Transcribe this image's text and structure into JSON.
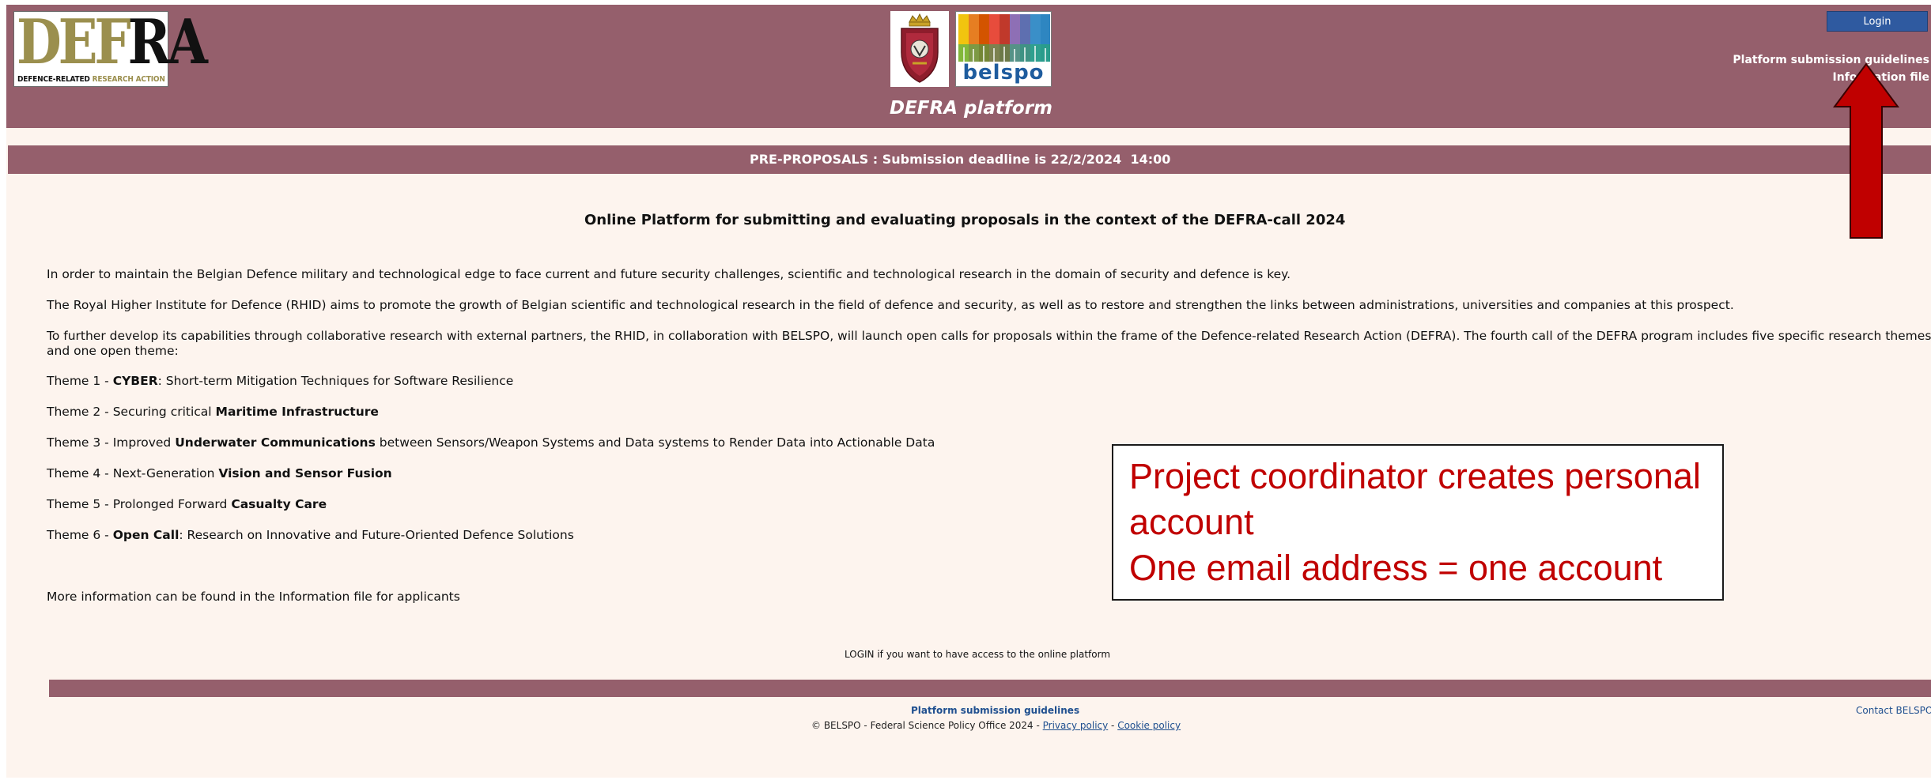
{
  "header": {
    "logo": {
      "big_part1": "DEF",
      "big_part2": "RA",
      "tag_part1": "DEFENCE-RELATED ",
      "tag_part2": "RESEARCH ACTION"
    },
    "belspo_label": "belspo",
    "platform_title": "DEFRA platform",
    "login_label": "Login",
    "links": {
      "guidelines": "Platform submission guidelines",
      "info_file": "Information file"
    }
  },
  "banner": {
    "text": "PRE-PROPOSALS : Submission deadline is 22/2/2024  14:00"
  },
  "main": {
    "heading": "Online Platform for submitting and evaluating proposals in the context of the DEFRA-call 2024",
    "paragraphs": [
      "In order to maintain the Belgian Defence military and technological edge to face current and future security challenges, scientific and technological research in the domain of security and defence is key.",
      "The Royal Higher Institute for Defence (RHID) aims to promote the growth of Belgian scientific and technological research in the field of defence and security, as well as to restore and strengthen the links between administrations, universities and companies at this prospect.",
      "To further develop its capabilities through collaborative research with external partners, the RHID, in collaboration with BELSPO, will launch open calls for proposals within the frame of the Defence-related Research Action (DEFRA). The fourth call of the DEFRA program includes five specific research themes and one open theme:"
    ],
    "themes": [
      {
        "prefix": "Theme 1 - ",
        "bold": "CYBER",
        "suffix": ": Short-term Mitigation Techniques for Software Resilience"
      },
      {
        "prefix": "Theme 2 - Securing critical ",
        "bold": "Maritime Infrastructure",
        "suffix": ""
      },
      {
        "prefix": "Theme 3 - Improved ",
        "bold": "Underwater Communications",
        "suffix": " between Sensors/Weapon Systems and Data systems to Render Data into Actionable Data"
      },
      {
        "prefix": "Theme 4 - Next-Generation ",
        "bold": "Vision and Sensor Fusion",
        "suffix": ""
      },
      {
        "prefix": "Theme 5 - Prolonged Forward ",
        "bold": "Casualty Care",
        "suffix": ""
      },
      {
        "prefix": "Theme 6 - ",
        "bold": "Open Call",
        "suffix": ": Research on Innovative and Future-Oriented Defence Solutions"
      }
    ],
    "more_info": "More information can be found in the Information file for applicants",
    "login_note": "LOGIN if you want to have access to the online platform"
  },
  "overlay": {
    "line1": "Project coordinator creates personal account",
    "line2": "One email address = one account",
    "text_color": "#c00000"
  },
  "footer": {
    "guidelines": "Platform submission guidelines",
    "contact": "Contact BELSPO",
    "copyright": "© BELSPO - Federal Science Policy Office 2024 - ",
    "privacy": "Privacy policy",
    "separator": " -  ",
    "cookie": "Cookie policy"
  },
  "colors": {
    "header_bg": "#955f6c",
    "page_bg": "#fdf4ee",
    "login_button": "#2f5aa0",
    "arrow": "#c00000",
    "link": "#1f4f8f"
  },
  "icons": {
    "emblem": "rhid-crest-icon",
    "belspo": "belspo-logo-icon",
    "arrow": "up-arrow-icon"
  }
}
